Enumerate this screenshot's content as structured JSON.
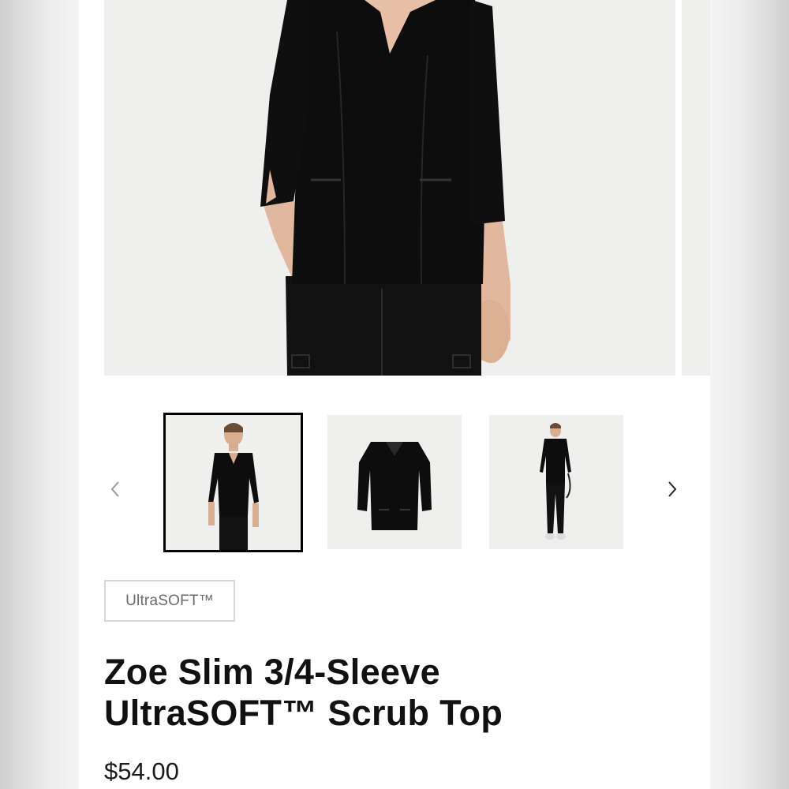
{
  "gallery": {
    "hero_alt": "Model wearing black scrub top, front view",
    "thumbnails": [
      {
        "alt": "Model front view",
        "selected": true
      },
      {
        "alt": "Scrub top flat lay"
      },
      {
        "alt": "Full-length model view"
      }
    ],
    "prev_icon": "chevron-left-icon",
    "next_icon": "chevron-right-icon"
  },
  "product": {
    "badge": "UltraSOFT™",
    "title_line1": "Zoe Slim 3/4-Sleeve",
    "title_line2": "UltraSOFT™ Scrub Top",
    "price": "$54.00"
  },
  "colors": {
    "garment": "#0d0d0d",
    "image_bg": "#efefed",
    "skin": "#e6bfa6"
  }
}
